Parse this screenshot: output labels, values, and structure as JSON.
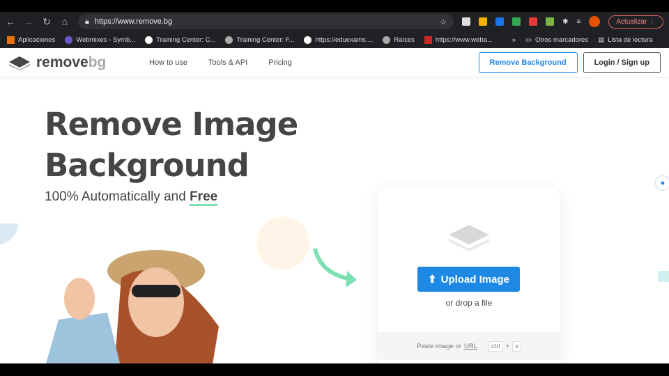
{
  "browser": {
    "url": "https://www.remove.bg",
    "update_label": "Actualizar",
    "bookmarks": [
      "Aplicaciones",
      "Webmixes - Symb...",
      "Training Center: C...",
      "Training Center: F...",
      "https://eduexams....",
      "Raíces",
      "https://www.weba..."
    ],
    "overflow": "»",
    "other_bookmarks": "Otros marcadores",
    "reading_list": "Lista de lectura"
  },
  "header": {
    "logo_main": "remove",
    "logo_accent": "bg",
    "nav": [
      "How to use",
      "Tools & API",
      "Pricing"
    ],
    "remove_bg_button": "Remove Background",
    "login_button": "Login / Sign up"
  },
  "hero": {
    "title_line1": "Remove Image",
    "title_line2": "Background",
    "subtitle": "100% Automatically and",
    "subtitle_bold": "Free"
  },
  "upload": {
    "button": "Upload Image",
    "drop_text": "or drop a file",
    "paste_text": "Paste image or",
    "url_link": "URL",
    "key1": "ctrl",
    "plus": "+",
    "key2": "v"
  }
}
